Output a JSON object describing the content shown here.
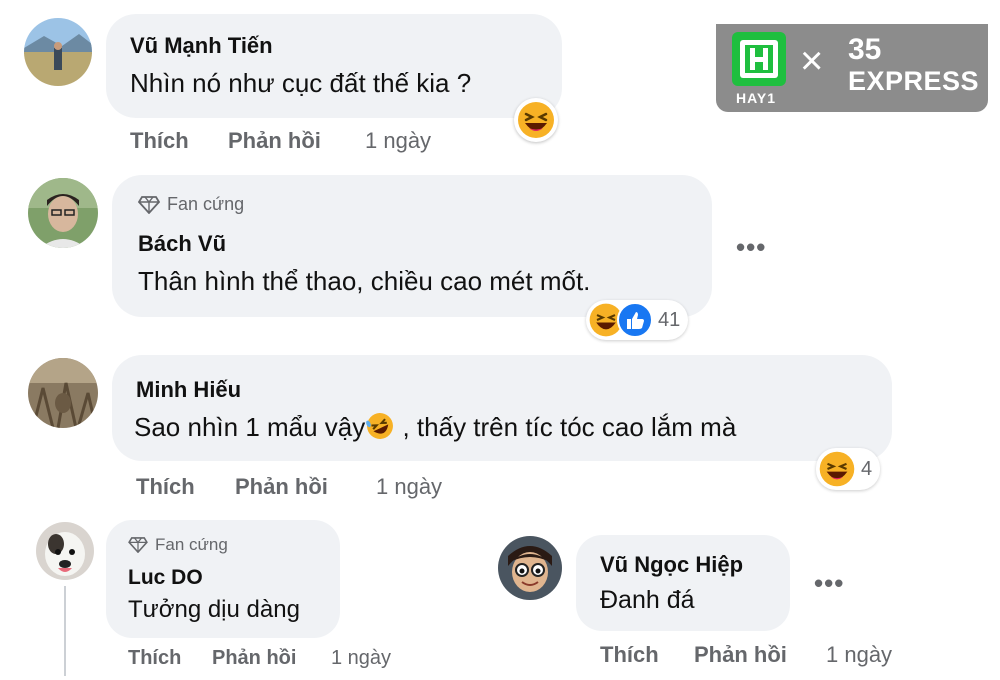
{
  "comments": [
    {
      "name": "Vũ Mạnh Tiến",
      "text": "Nhìn nó như cục đất thế kia ?",
      "like": "Thích",
      "reply": "Phản hồi",
      "time": "1 ngày"
    },
    {
      "badge": "Fan cứng",
      "name": "Bách Vũ",
      "text": "Thân hình thể thao, chiều cao mét mốt.",
      "reaction_count": "41",
      "more": "•••"
    },
    {
      "name": "Minh Hiếu",
      "text_before": "Sao nhìn 1 mẩu vậy",
      "text_after": " , thấy trên tíc tóc cao lắm mà",
      "reaction_count": "4",
      "like": "Thích",
      "reply": "Phản hồi",
      "time": "1 ngày"
    },
    {
      "badge": "Fan cứng",
      "name": "Luc DO",
      "text": "Tưởng dịu dàng",
      "like": "Thích",
      "reply": "Phản hồi",
      "time": "1 ngày"
    },
    {
      "name": "Vũ Ngọc Hiệp",
      "text": "Đanh đá",
      "like": "Thích",
      "reply": "Phản hồi",
      "time": "1 ngày",
      "more": "•••"
    }
  ],
  "watermark": {
    "brand": "HAY1",
    "cross": "×",
    "partner_num": "35",
    "partner_word": "EXPRESS"
  },
  "colors": {
    "bubble": "#f0f2f5",
    "meta": "#65676b",
    "haha": "#f7b125",
    "like_blue": "#1877f2",
    "brand_green": "#1fbf3f"
  }
}
